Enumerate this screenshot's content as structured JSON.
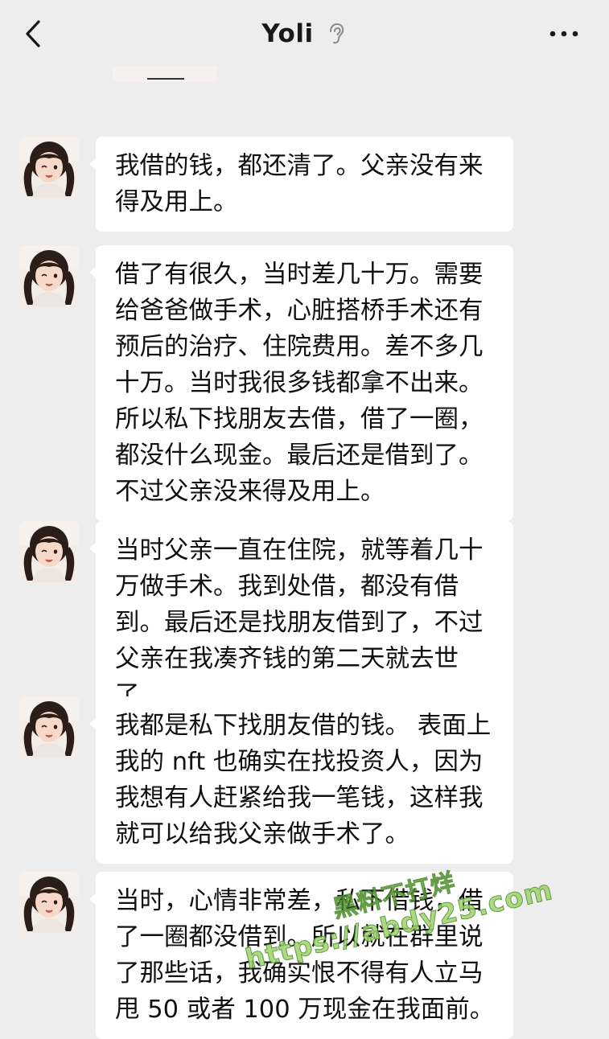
{
  "header": {
    "title": "Yoli",
    "back_icon": "chevron-left-icon",
    "ear_icon": "ear-icon",
    "more_icon": "more-dots-icon"
  },
  "messages": [
    {
      "text": "我借的钱，都还清了。父亲没有来得及用上。"
    },
    {
      "text": "借了有很久，当时差几十万。需要给爸爸做手术，心脏搭桥手术还有预后的治疗、住院费用。差不多几十万。当时我很多钱都拿不出来。所以私下找朋友去借，借了一圈，都没什么现金。最后还是借到了。不过父亲没来得及用上。"
    },
    {
      "text": "当时父亲一直在住院，就等着几十万做手术。我到处借，都没有借到。最后还是找朋友借到了，不过父亲在我凑齐钱的第二天就去世了。"
    },
    {
      "text": "我都是私下找朋友借的钱。 表面上我的 nft 也确实在找投资人，因为我想有人赶紧给我一笔钱，这样我就可以给我父亲做手术了。"
    },
    {
      "text": "当时，心情非常差，私下借钱，借了一圈都没借到。所以就在群里说了那些话，我确实恨不得有人立马甩 50 或者 100 万现金在我面前。"
    }
  ],
  "watermark": {
    "line1": "黑料不打烊",
    "line2": "https://abdy25.com"
  },
  "colors": {
    "background": "#ededed",
    "bubble": "#ffffff",
    "text": "#111111",
    "watermark": "#9fd36a"
  }
}
